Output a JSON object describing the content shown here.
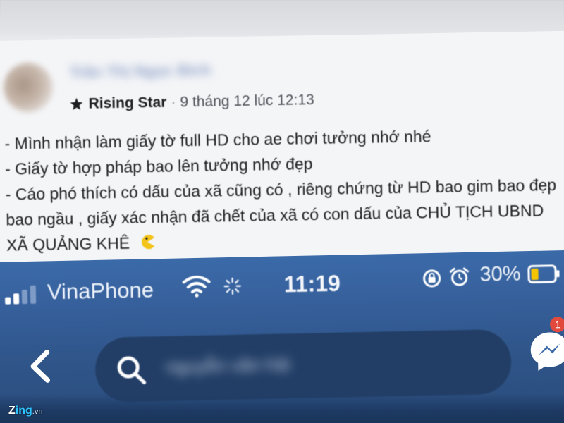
{
  "post": {
    "author_name": "Trần Thị Ngọc Bích",
    "badge": "Rising Star",
    "separator": "·",
    "timestamp": "9 tháng 12 lúc 12:13",
    "lines": [
      "- Mình nhận làm giấy tờ full HD cho ae chơi tưởng nhớ nhé",
      "- Giấy tờ hợp pháp bao lên tưởng nhớ đẹp",
      "- Cáo phó thích có dấu của xã cũng có , riêng chứng từ HD bao gim bao đẹp",
      "bao ngầu , giấy xác nhận đã chết của xã có con dấu của CHỦ TỊCH UBND",
      "XÃ QUẢNG KHÊ"
    ],
    "emoji": "pacman-emoji-icon"
  },
  "status_bar": {
    "carrier": "VinaPhone",
    "time": "11:19",
    "battery": "30%"
  },
  "search": {
    "query": "nguyễn văn hải"
  },
  "messenger": {
    "badge_count": "1"
  },
  "watermark": {
    "brand_a": "Z",
    "brand_b": "ing",
    "tld": ".vn"
  },
  "colors": {
    "facebook_blue": "#3b6aa9",
    "search_field": "#223e66",
    "badge_red": "#e14a3c",
    "emoji_yellow": "#f2c318",
    "battery_yellow": "#f5c400"
  }
}
